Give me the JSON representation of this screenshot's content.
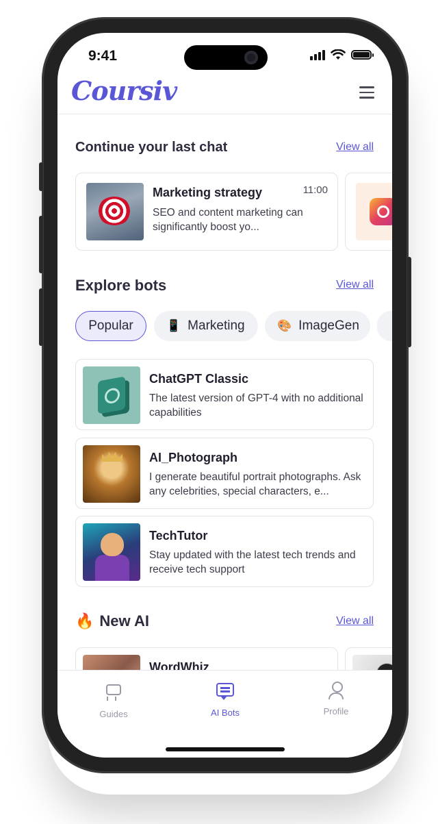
{
  "status": {
    "time": "9:41"
  },
  "header": {
    "logo": "Coursiv"
  },
  "continue_chat": {
    "title": "Continue your last chat",
    "view_all": "View all",
    "chats": [
      {
        "title": "Marketing strategy",
        "time": "11:00",
        "preview": "SEO and content marketing can significantly boost yo..."
      }
    ]
  },
  "explore_bots": {
    "title": "Explore bots",
    "view_all": "View all",
    "chips": [
      {
        "label": "Popular",
        "emoji": ""
      },
      {
        "label": "Marketing",
        "emoji": "📱"
      },
      {
        "label": "ImageGen",
        "emoji": "🎨"
      }
    ],
    "bots": [
      {
        "name": "ChatGPT Classic",
        "desc": "The latest version of GPT-4 with no additional capabilities"
      },
      {
        "name": "AI_Photograph",
        "desc": "I generate beautiful portrait photographs. Ask any celebrities, special characters, e..."
      },
      {
        "name": "TechTutor",
        "desc": "Stay updated with the latest tech trends and receive tech support"
      }
    ]
  },
  "new_ai": {
    "emoji": "🔥",
    "title": "New AI",
    "view_all": "View all",
    "items": [
      {
        "name": "WordWhiz"
      }
    ]
  },
  "tabbar": {
    "tabs": [
      {
        "label": "Guides",
        "icon": "guides-icon"
      },
      {
        "label": "AI Bots",
        "icon": "chat-bot-icon"
      },
      {
        "label": "Profile",
        "icon": "profile-icon"
      }
    ],
    "active": "AI Bots"
  },
  "colors": {
    "accent": "#5b56d6",
    "text": "#2c2c3e"
  }
}
